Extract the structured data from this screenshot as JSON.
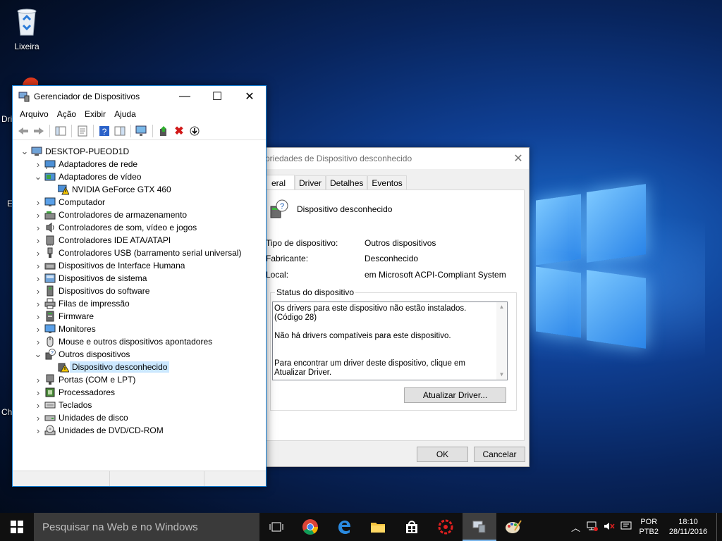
{
  "desktop": {
    "recycle_label": "Lixeira",
    "edge_texts": [
      "Dri",
      "E",
      "Ch"
    ]
  },
  "devmgr": {
    "title": "Gerenciador de Dispositivos",
    "menu": [
      "Arquivo",
      "Ação",
      "Exibir",
      "Ajuda"
    ],
    "tree": [
      {
        "label": "DESKTOP-PUEOD1D",
        "level": 0,
        "expander": "expanded",
        "icon": "computer-icon"
      },
      {
        "label": "Adaptadores de rede",
        "level": 1,
        "expander": "collapsed",
        "icon": "network-adapter-icon"
      },
      {
        "label": "Adaptadores de vídeo",
        "level": 1,
        "expander": "expanded",
        "icon": "display-adapter-icon"
      },
      {
        "label": "NVIDIA GeForce GTX 460",
        "level": 2,
        "expander": "none",
        "icon": "warning-display-icon"
      },
      {
        "label": "Computador",
        "level": 1,
        "expander": "collapsed",
        "icon": "monitor-icon"
      },
      {
        "label": "Controladores de armazenamento",
        "level": 1,
        "expander": "collapsed",
        "icon": "storage-controller-icon"
      },
      {
        "label": "Controladores de som, vídeo e jogos",
        "level": 1,
        "expander": "collapsed",
        "icon": "speaker-icon"
      },
      {
        "label": "Controladores IDE ATA/ATAPI",
        "level": 1,
        "expander": "collapsed",
        "icon": "ide-controller-icon"
      },
      {
        "label": "Controladores USB (barramento serial universal)",
        "level": 1,
        "expander": "collapsed",
        "icon": "usb-icon"
      },
      {
        "label": "Dispositivos de Interface Humana",
        "level": 1,
        "expander": "collapsed",
        "icon": "hid-icon"
      },
      {
        "label": "Dispositivos de sistema",
        "level": 1,
        "expander": "collapsed",
        "icon": "system-device-icon"
      },
      {
        "label": "Dispositivos do software",
        "level": 1,
        "expander": "collapsed",
        "icon": "software-device-icon"
      },
      {
        "label": "Filas de impressão",
        "level": 1,
        "expander": "collapsed",
        "icon": "printer-icon"
      },
      {
        "label": "Firmware",
        "level": 1,
        "expander": "collapsed",
        "icon": "firmware-icon"
      },
      {
        "label": "Monitores",
        "level": 1,
        "expander": "collapsed",
        "icon": "monitor-icon"
      },
      {
        "label": "Mouse e outros dispositivos apontadores",
        "level": 1,
        "expander": "collapsed",
        "icon": "mouse-icon"
      },
      {
        "label": "Outros dispositivos",
        "level": 1,
        "expander": "expanded",
        "icon": "unknown-device-icon"
      },
      {
        "label": "Dispositivo desconhecido",
        "level": 2,
        "expander": "none",
        "icon": "warning-device-icon",
        "selected": true
      },
      {
        "label": "Portas (COM e LPT)",
        "level": 1,
        "expander": "collapsed",
        "icon": "port-icon"
      },
      {
        "label": "Processadores",
        "level": 1,
        "expander": "collapsed",
        "icon": "processor-icon"
      },
      {
        "label": "Teclados",
        "level": 1,
        "expander": "collapsed",
        "icon": "keyboard-icon"
      },
      {
        "label": "Unidades de disco",
        "level": 1,
        "expander": "collapsed",
        "icon": "disk-drive-icon"
      },
      {
        "label": "Unidades de DVD/CD-ROM",
        "level": 1,
        "expander": "collapsed",
        "icon": "dvd-icon"
      }
    ]
  },
  "props": {
    "title": "priedades de Dispositivo desconhecido",
    "tabs": [
      "eral",
      "Driver",
      "Detalhes",
      "Eventos"
    ],
    "device_name": "Dispositivo desconhecido",
    "fields": [
      {
        "key": "Tipo de dispositivo:",
        "value": "Outros dispositivos"
      },
      {
        "key": "Fabricante:",
        "value": "Desconhecido"
      },
      {
        "key": "Local:",
        "value": "em Microsoft ACPI-Compliant System"
      }
    ],
    "status_group_title": "Status do dispositivo",
    "status_lines": [
      "Os drivers para este dispositivo não estão instalados. (Código 28)",
      "Não há drivers compatíveis para este dispositivo.",
      "Para encontrar um driver deste dispositivo, clique em Atualizar Driver."
    ],
    "update_button": "Atualizar Driver...",
    "ok_button": "OK",
    "cancel_button": "Cancelar"
  },
  "taskbar": {
    "search_placeholder": "Pesquisar na Web e no Windows",
    "lang_line1": "POR",
    "lang_line2": "PTB2",
    "time": "18:10",
    "date": "28/11/2016"
  },
  "colors": {
    "accent": "#1883d7",
    "selection": "#cce8ff",
    "taskbar": "#101010",
    "search_box": "#3a3a3a"
  }
}
